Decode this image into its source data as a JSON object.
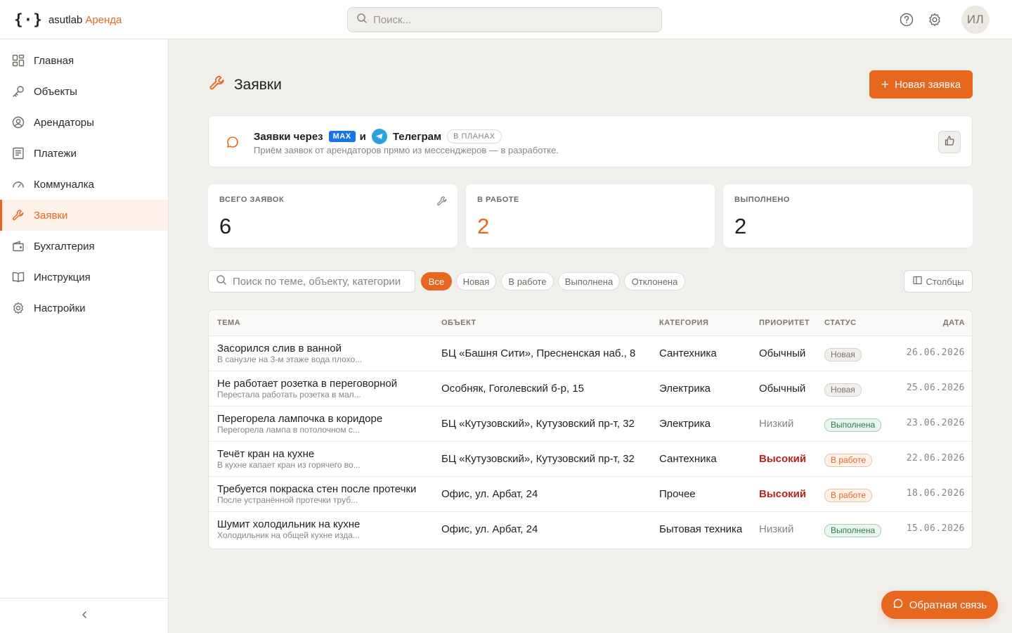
{
  "brand": {
    "mark": "{·}",
    "name": "asutlab",
    "accent": "Аренда"
  },
  "search": {
    "placeholder": "Поиск..."
  },
  "user": {
    "initials": "ИЛ"
  },
  "sidebar": {
    "items": [
      {
        "label": "Главная",
        "icon": "dashboard-icon"
      },
      {
        "label": "Объекты",
        "icon": "key-icon"
      },
      {
        "label": "Арендаторы",
        "icon": "user-circle-icon"
      },
      {
        "label": "Платежи",
        "icon": "receipt-icon"
      },
      {
        "label": "Коммуналка",
        "icon": "gauge-icon"
      },
      {
        "label": "Заявки",
        "icon": "wrench-icon",
        "active": true
      },
      {
        "label": "Бухгалтерия",
        "icon": "wallet-icon"
      },
      {
        "label": "Инструкция",
        "icon": "book-icon"
      },
      {
        "label": "Настройки",
        "icon": "gear-icon"
      }
    ],
    "collapse_icon": "chevron-left-icon"
  },
  "page": {
    "title": "Заявки",
    "new_button": "Новая заявка"
  },
  "banner": {
    "prefix": "Заявки через",
    "max_badge": "MAX",
    "conj": "и",
    "telegram": "Телеграм",
    "status": "В ПЛАНАХ",
    "subtitle": "Приём заявок от арендаторов прямо из мессенджеров — в разработке."
  },
  "stats": [
    {
      "label": "ВСЕГО ЗАЯВОК",
      "value": "6"
    },
    {
      "label": "В РАБОТЕ",
      "value": "2"
    },
    {
      "label": "ВЫПОЛНЕНО",
      "value": "2"
    }
  ],
  "filters": {
    "search_placeholder": "Поиск по теме, объекту, категории",
    "chips": [
      "Все",
      "Новая",
      "В работе",
      "Выполнена",
      "Отклонена"
    ],
    "active_chip": "Все",
    "columns_button": "Столбцы"
  },
  "table": {
    "headers": {
      "topic": "ТЕМА",
      "object": "ОБЪЕКТ",
      "category": "КАТЕГОРИЯ",
      "priority": "ПРИОРИТЕТ",
      "status": "СТАТУС",
      "date": "ДАТА"
    },
    "rows": [
      {
        "title": "Засорился слив в ванной",
        "desc": "В санузле на 3-м этаже вода плохо...",
        "object": "БЦ «Башня Сити», Пресненская наб., 8",
        "category": "Сантехника",
        "priority": "Обычный",
        "status": "Новая",
        "date": "26.06.2026"
      },
      {
        "title": "Не работает розетка в переговорной",
        "desc": "Перестала работать розетка в мал...",
        "object": "Особняк, Гоголевский б-р, 15",
        "category": "Электрика",
        "priority": "Обычный",
        "status": "Новая",
        "date": "25.06.2026"
      },
      {
        "title": "Перегорела лампочка в коридоре",
        "desc": "Перегорела лампа в потолочном с...",
        "object": "БЦ «Кутузовский», Кутузовский пр-т, 32",
        "category": "Электрика",
        "priority": "Низкий",
        "status": "Выполнена",
        "date": "23.06.2026"
      },
      {
        "title": "Течёт кран на кухне",
        "desc": "В кухне капает кран из горячего во...",
        "object": "БЦ «Кутузовский», Кутузовский пр-т, 32",
        "category": "Сантехника",
        "priority": "Высокий",
        "status": "В работе",
        "date": "22.06.2026"
      },
      {
        "title": "Требуется покраска стен после протечки",
        "desc": "После устранённой протечки труб...",
        "object": "Офис, ул. Арбат, 24",
        "category": "Прочее",
        "priority": "Высокий",
        "status": "В работе",
        "date": "18.06.2026"
      },
      {
        "title": "Шумит холодильник на кухне",
        "desc": "Холодильник на общей кухне изда...",
        "object": "Офис, ул. Арбат, 24",
        "category": "Бытовая техника",
        "priority": "Низкий",
        "status": "Выполнена",
        "date": "15.06.2026"
      }
    ]
  },
  "feedback_button": "Обратная связь",
  "colors": {
    "accent": "#e8671f",
    "background": "#f1efeb",
    "high_priority": "#b3261e",
    "done": "#2e7d4f"
  }
}
